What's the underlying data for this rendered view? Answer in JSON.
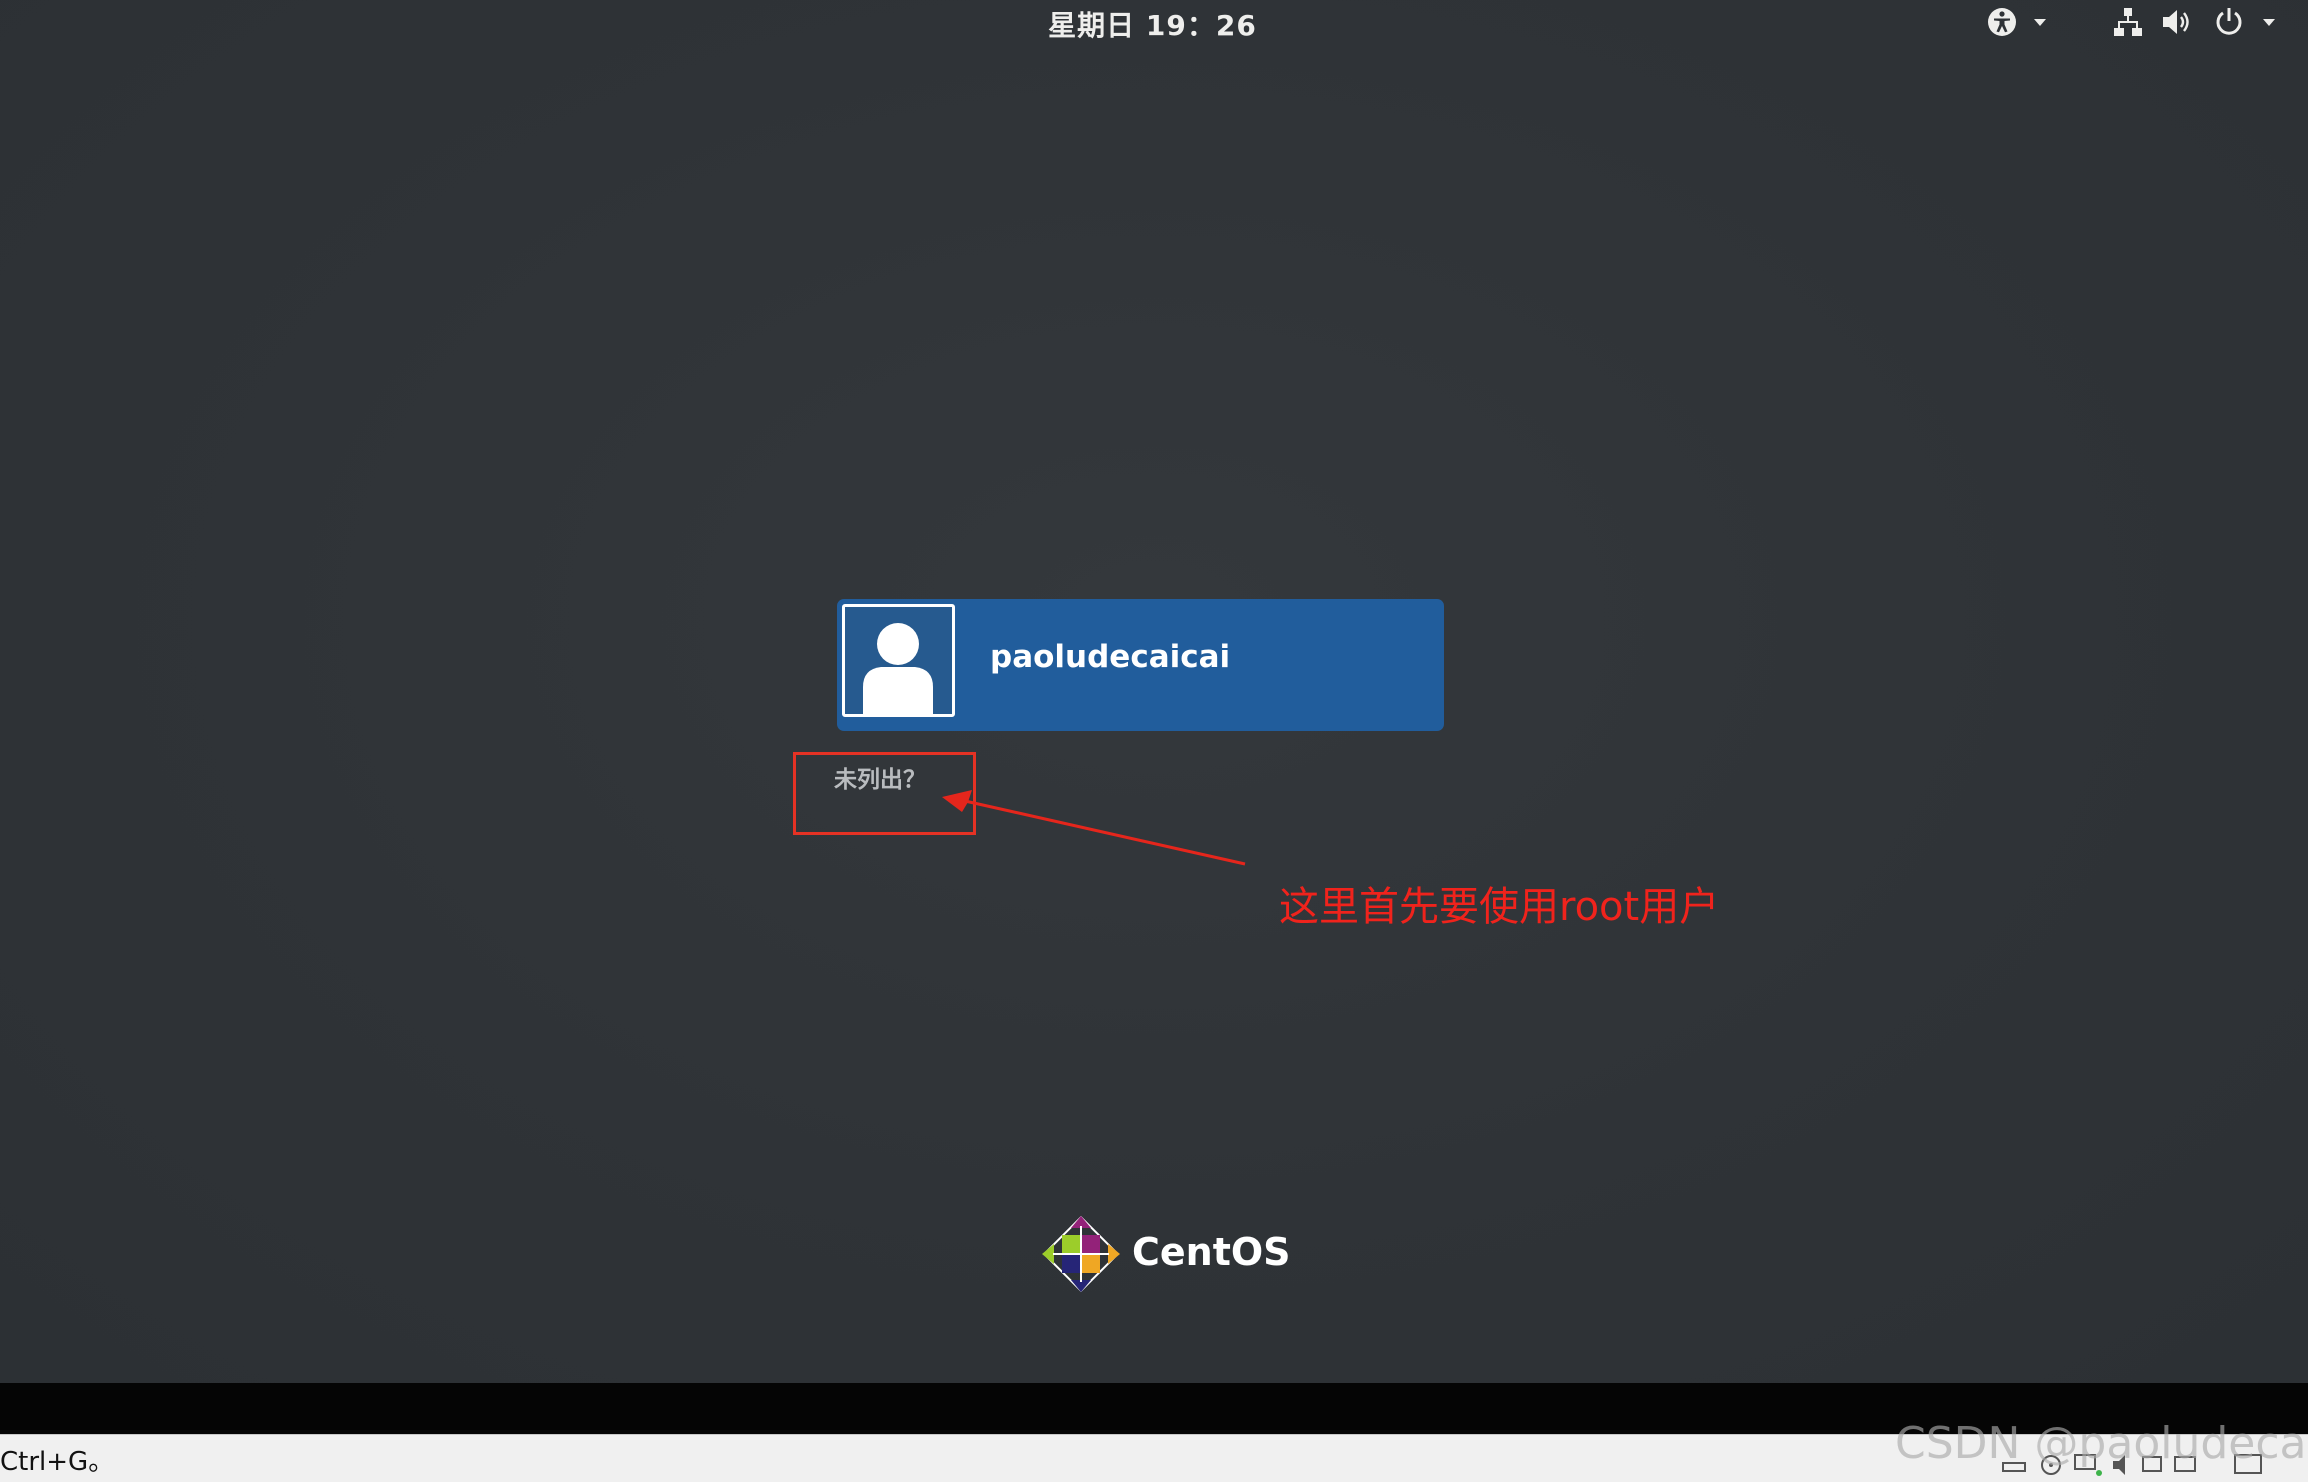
{
  "topbar": {
    "clock": "星期日 19：26",
    "accessibility_icon": "accessibility-icon",
    "network_icon": "network-icon",
    "volume_icon": "volume-icon",
    "power_icon": "power-icon"
  },
  "login": {
    "username": "paoludecaicai",
    "not_listed_label": "未列出？"
  },
  "annotation": {
    "text": "这里首先要使用root用户",
    "color": "#f0231c"
  },
  "branding": {
    "logo_text": "CentOS"
  },
  "statusbar": {
    "hint_text": "Ctrl+G。"
  },
  "watermark": {
    "text": "CSDN @paoludecaicai"
  },
  "colors": {
    "background": "#2e3236",
    "user_card": "#215d9c",
    "highlight": "#e53224"
  }
}
